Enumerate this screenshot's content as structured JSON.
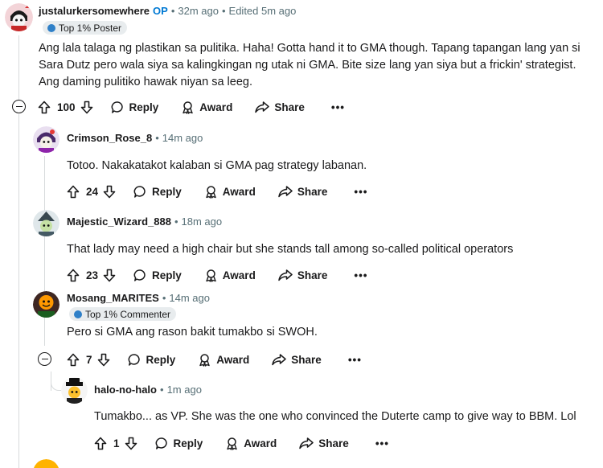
{
  "comments": [
    {
      "user": "justalurkersomewhere",
      "op_badge": "OP",
      "sep": "•",
      "time": "32m ago",
      "sep2": "•",
      "edited": "Edited 5m ago",
      "flair": "Top 1% Poster",
      "body_lines": [
        "Ang lala talaga ng plastikan sa pulitika. Haha! Gotta hand it to GMA though. Tapang tapangan lang yan si",
        "Sara Dutz pero wala siya sa kalingkingan ng utak ni GMA. Bite size lang yan siya but a frickin' strategist.",
        "Ang daming pulitiko hawak niyan sa leeg."
      ],
      "votes": "100",
      "reply": "Reply",
      "award": "Award",
      "share": "Share",
      "more": "•••"
    },
    {
      "user": "Crimson_Rose_8",
      "sep": "•",
      "time": "14m ago",
      "body": "Totoo. Nakakatakot kalaban si GMA pag strategy labanan.",
      "votes": "24",
      "reply": "Reply",
      "award": "Award",
      "share": "Share",
      "more": "•••"
    },
    {
      "user": "Majestic_Wizard_888",
      "sep": "•",
      "time": "18m ago",
      "body": "That lady may need a high chair but she stands tall among so-called political operators",
      "votes": "23",
      "reply": "Reply",
      "award": "Award",
      "share": "Share",
      "more": "•••"
    },
    {
      "user": "Mosang_MARITES",
      "sep": "•",
      "time": "14m ago",
      "flair": "Top 1% Commenter",
      "body": "Pero si GMA ang rason bakit tumakbo si SWOH.",
      "votes": "7",
      "reply": "Reply",
      "award": "Award",
      "share": "Share",
      "more": "•••"
    },
    {
      "user": "halo-no-halo",
      "sep": "•",
      "time": "1m ago",
      "body": "Tumakbo... as VP. She was the one who convinced the Duterte camp to give way to BBM. Lol",
      "votes": "1",
      "reply": "Reply",
      "award": "Award",
      "share": "Share",
      "more": "•••"
    }
  ],
  "colors": {
    "op": "#0079d3",
    "meta": "#576f76",
    "thread_line": "#d7dadc",
    "flair_bg": "#e8ecee"
  }
}
